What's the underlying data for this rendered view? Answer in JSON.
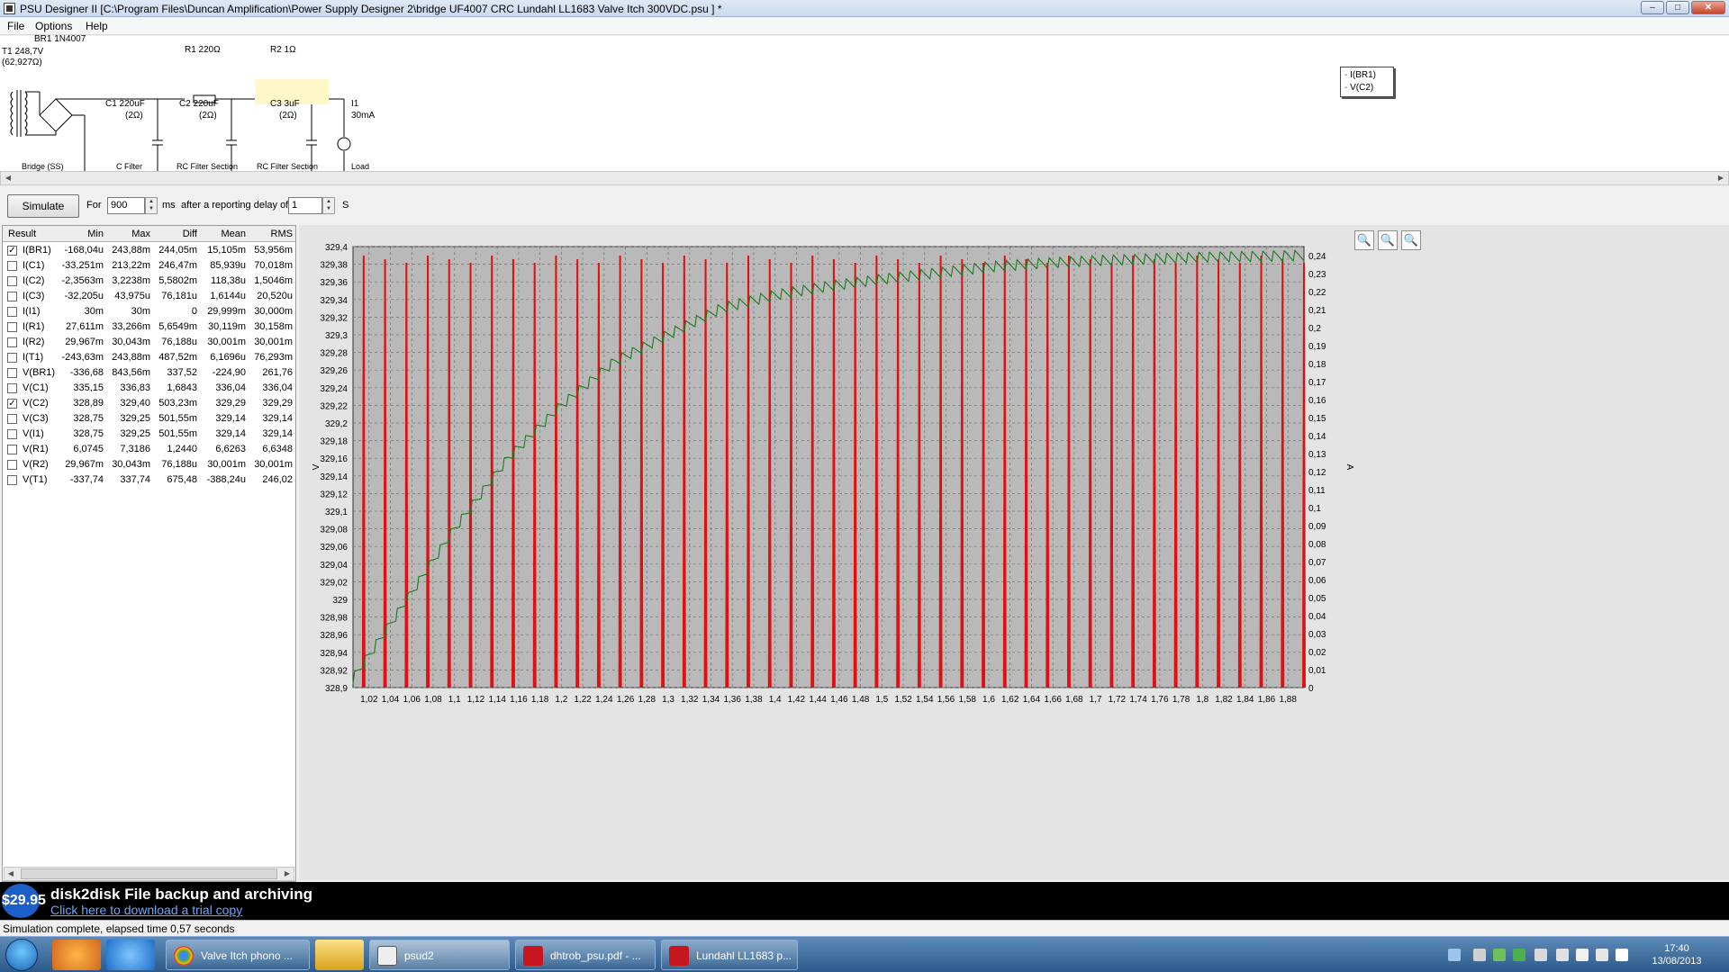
{
  "window": {
    "title": "PSU Designer II  [C:\\Program Files\\Duncan Amplification\\Power Supply Designer 2\\bridge UF4007 CRC Lundahl LL1683 Valve Itch 300VDC.psu ] *",
    "minimize": "–",
    "maximize": "□",
    "close": "✕"
  },
  "menu": [
    "File",
    "Options",
    "Help"
  ],
  "schematic": {
    "br1": "BR1 1N4007",
    "t1_a": "T1 248,7V",
    "t1_b": "(62,927Ω)",
    "r1": "R1 220Ω",
    "r2": "R2 1Ω",
    "c1_a": "C1 220uF",
    "c1_b": "(2Ω)",
    "c2_a": "C2 220uF",
    "c2_b": "(2Ω)",
    "c3_a": "C3 3uF",
    "c3_b": "(2Ω)",
    "i1_a": "I1",
    "i1_b": "30mA",
    "sections": [
      "Bridge (SS)",
      "C Filter",
      "RC Filter Section",
      "RC Filter Section",
      "Load"
    ]
  },
  "sim": {
    "button": "Simulate",
    "for_label": "For",
    "duration": "900",
    "ms_label": "ms",
    "delay_label": "after a reporting delay of",
    "delay": "1",
    "s_label": "S"
  },
  "results": {
    "headers": [
      "Result",
      "Min",
      "Max",
      "Diff",
      "Mean",
      "RMS"
    ],
    "rows": [
      {
        "checked": true,
        "cells": [
          "I(BR1)",
          "-168,04u",
          "243,88m",
          "244,05m",
          "15,105m",
          "53,956m"
        ]
      },
      {
        "checked": false,
        "cells": [
          "I(C1)",
          "-33,251m",
          "213,22m",
          "246,47m",
          "85,939u",
          "70,018m"
        ]
      },
      {
        "checked": false,
        "cells": [
          "I(C2)",
          "-2,3563m",
          "3,2238m",
          "5,5802m",
          "118,38u",
          "1,5046m"
        ]
      },
      {
        "checked": false,
        "cells": [
          "I(C3)",
          "-32,205u",
          "43,975u",
          "76,181u",
          "1,6144u",
          "20,520u"
        ]
      },
      {
        "checked": false,
        "cells": [
          "I(I1)",
          "30m",
          "30m",
          "0",
          "29,999m",
          "30,000m"
        ]
      },
      {
        "checked": false,
        "cells": [
          "I(R1)",
          "27,611m",
          "33,266m",
          "5,6549m",
          "30,119m",
          "30,158m"
        ]
      },
      {
        "checked": false,
        "cells": [
          "I(R2)",
          "29,967m",
          "30,043m",
          "76,188u",
          "30,001m",
          "30,001m"
        ]
      },
      {
        "checked": false,
        "cells": [
          "I(T1)",
          "-243,63m",
          "243,88m",
          "487,52m",
          "6,1696u",
          "76,293m"
        ]
      },
      {
        "checked": false,
        "cells": [
          "V(BR1)",
          "-336,68",
          "843,56m",
          "337,52",
          "-224,90",
          "261,76"
        ]
      },
      {
        "checked": false,
        "cells": [
          "V(C1)",
          "335,15",
          "336,83",
          "1,6843",
          "336,04",
          "336,04"
        ]
      },
      {
        "checked": true,
        "cells": [
          "V(C2)",
          "328,89",
          "329,40",
          "503,23m",
          "329,29",
          "329,29"
        ]
      },
      {
        "checked": false,
        "cells": [
          "V(C3)",
          "328,75",
          "329,25",
          "501,55m",
          "329,14",
          "329,14"
        ]
      },
      {
        "checked": false,
        "cells": [
          "V(I1)",
          "328,75",
          "329,25",
          "501,55m",
          "329,14",
          "329,14"
        ]
      },
      {
        "checked": false,
        "cells": [
          "V(R1)",
          "6,0745",
          "7,3186",
          "1,2440",
          "6,6263",
          "6,6348"
        ]
      },
      {
        "checked": false,
        "cells": [
          "V(R2)",
          "29,967m",
          "30,043m",
          "76,188u",
          "30,001m",
          "30,001m"
        ]
      },
      {
        "checked": false,
        "cells": [
          "V(T1)",
          "-337,74",
          "337,74",
          "675,48",
          "-388,24u",
          "246,02"
        ]
      }
    ]
  },
  "chart_data": {
    "type": "line",
    "ylabel": "V",
    "y2label": "A",
    "xlim": [
      1.005,
      1.895
    ],
    "ylim": [
      328.9,
      329.4
    ],
    "y2lim": [
      0,
      0.245
    ],
    "grid": true,
    "legend_position": "right",
    "x_ticks": [
      "1,02",
      "1,04",
      "1,06",
      "1,08",
      "1,1",
      "1,12",
      "1,14",
      "1,16",
      "1,18",
      "1,2",
      "1,22",
      "1,24",
      "1,26",
      "1,28",
      "1,3",
      "1,32",
      "1,34",
      "1,36",
      "1,38",
      "1,4",
      "1,42",
      "1,44",
      "1,46",
      "1,48",
      "1,5",
      "1,52",
      "1,54",
      "1,56",
      "1,58",
      "1,6",
      "1,62",
      "1,64",
      "1,66",
      "1,68",
      "1,7",
      "1,72",
      "1,74",
      "1,76",
      "1,78",
      "1,8",
      "1,82",
      "1,84",
      "1,86",
      "1,88"
    ],
    "y_ticks": [
      "328,9",
      "328,92",
      "328,94",
      "328,96",
      "328,98",
      "329",
      "329,02",
      "329,04",
      "329,06",
      "329,08",
      "329,1",
      "329,12",
      "329,14",
      "329,16",
      "329,18",
      "329,2",
      "329,22",
      "329,24",
      "329,26",
      "329,28",
      "329,3",
      "329,32",
      "329,34",
      "329,36",
      "329,38",
      "329,4"
    ],
    "y2_ticks": [
      "0",
      "0,01",
      "0,02",
      "0,03",
      "0,04",
      "0,05",
      "0,06",
      "0,07",
      "0,08",
      "0,09",
      "0,1",
      "0,11",
      "0,12",
      "0,13",
      "0,14",
      "0,15",
      "0,16",
      "0,17",
      "0,18",
      "0,19",
      "0,2",
      "0,21",
      "0,22",
      "0,23",
      "0,24"
    ],
    "series": [
      {
        "name": "I(BR1)",
        "color": "#e01010",
        "axis": "right",
        "pulse_period": 0.02,
        "pulse_phase": 1.015,
        "pulse_peak": 0.24,
        "pulse_width": 0.0016
      },
      {
        "name": "V(C2)",
        "color": "#1a7a1a",
        "axis": "left",
        "ripple_period": 0.01,
        "ripple_pp": 0.012,
        "envelope": [
          [
            1.005,
            328.91
          ],
          [
            1.05,
            328.99
          ],
          [
            1.1,
            329.08
          ],
          [
            1.15,
            329.16
          ],
          [
            1.2,
            329.22
          ],
          [
            1.25,
            329.27
          ],
          [
            1.3,
            329.3
          ],
          [
            1.35,
            329.33
          ],
          [
            1.4,
            329.345
          ],
          [
            1.45,
            329.355
          ],
          [
            1.5,
            329.363
          ],
          [
            1.55,
            329.37
          ],
          [
            1.6,
            329.377
          ],
          [
            1.65,
            329.381
          ],
          [
            1.7,
            329.384
          ],
          [
            1.75,
            329.386
          ],
          [
            1.8,
            329.388
          ],
          [
            1.85,
            329.389
          ],
          [
            1.895,
            329.39
          ]
        ]
      }
    ]
  },
  "zoom": [
    "zoom-in-icon",
    "zoom-out-icon",
    "zoom-reset-icon"
  ],
  "ad": {
    "price": "$29.95",
    "title": "disk2disk File backup and archiving",
    "link": "Click here to download a trial copy"
  },
  "status": "Simulation complete, elapsed time 0,57 seconds",
  "taskbar": {
    "tasks": [
      "Valve Itch phono ...",
      "psud2",
      "dhtrob_psu.pdf - ...",
      "Lundahl LL1683 p..."
    ],
    "time": "17:40",
    "date": "13/08/2013"
  }
}
